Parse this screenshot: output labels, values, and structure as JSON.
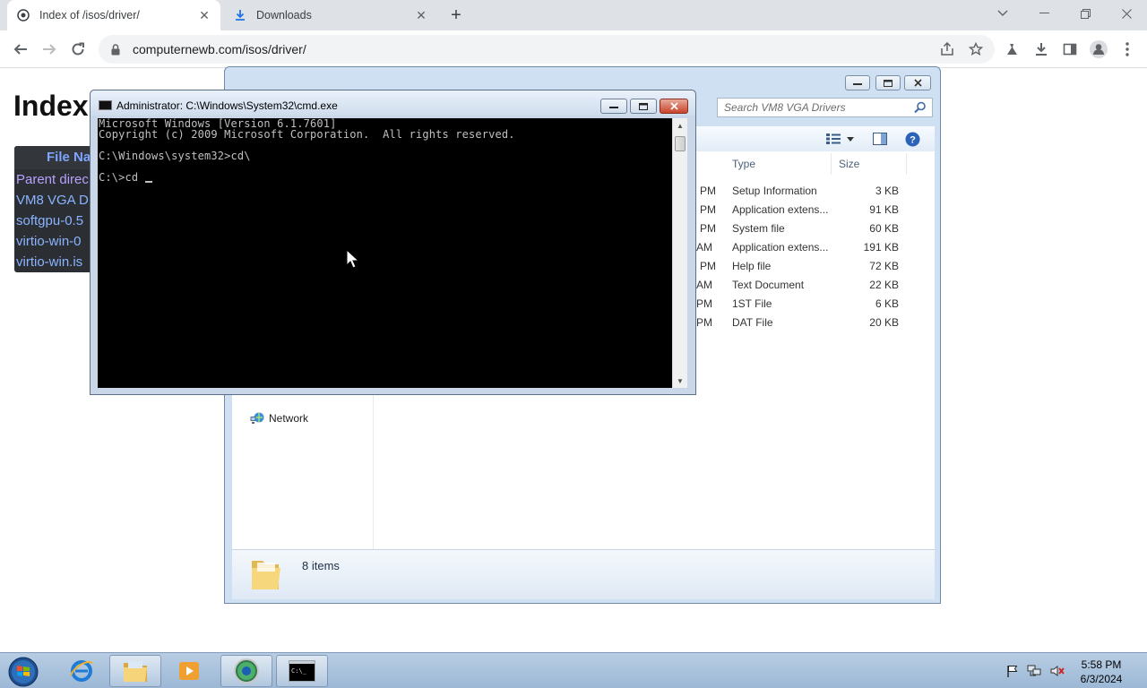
{
  "browser": {
    "tabs": [
      {
        "title": "Index of /isos/driver/",
        "active": true
      },
      {
        "title": "Downloads",
        "active": false
      }
    ],
    "url": "computernewb.com/isos/driver/"
  },
  "webpage": {
    "heading": "Index",
    "table_header": "File Na",
    "rows": [
      "Parent direc",
      "VM8 VGA D",
      "softgpu-0.5",
      "virtio-win-0",
      "virtio-win.is"
    ]
  },
  "explorer": {
    "search_placeholder": "Search VM8 VGA Drivers",
    "columns": {
      "type": "Type",
      "size": "Size"
    },
    "files": [
      {
        "time": "PM",
        "type": "Setup Information",
        "size": "3 KB"
      },
      {
        "time": "PM",
        "type": "Application extens...",
        "size": "91 KB"
      },
      {
        "time": "PM",
        "type": "System file",
        "size": "60 KB"
      },
      {
        "time": "AM",
        "type": "Application extens...",
        "size": "191 KB"
      },
      {
        "time": "PM",
        "type": "Help file",
        "size": "72 KB"
      },
      {
        "time": "AM",
        "type": "Text Document",
        "size": "22 KB"
      },
      {
        "time": "PM",
        "type": "1ST File",
        "size": "6 KB"
      },
      {
        "time": "PM",
        "type": "DAT File",
        "size": "20 KB"
      }
    ],
    "nav_network": "Network",
    "item_count": "8 items"
  },
  "cmd": {
    "title": "Administrator: C:\\Windows\\System32\\cmd.exe",
    "lines": [
      "Microsoft Windows [Version 6.1.7601]",
      "Copyright (c) 2009 Microsoft Corporation.  All rights reserved.",
      "",
      "C:\\Windows\\system32>cd\\",
      "",
      "C:\\>cd "
    ]
  },
  "taskbar": {
    "time": "5:58 PM",
    "date": "6/3/2024"
  },
  "colors": {
    "console_bg": "#000000",
    "console_fg": "#c0c0c0",
    "link": "#8ab4ff"
  }
}
